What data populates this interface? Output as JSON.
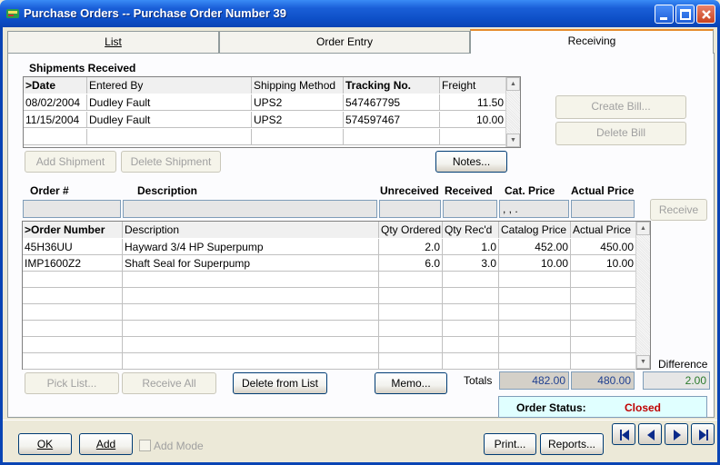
{
  "window": {
    "title": "Purchase Orders -- Purchase Order Number 39",
    "minimize_icon": "minimize-icon",
    "maximize_icon": "maximize-icon",
    "close_icon": "close-icon"
  },
  "tabs": [
    {
      "label": "List"
    },
    {
      "label": "Order Entry"
    },
    {
      "label": "Receiving",
      "active": true
    }
  ],
  "shipments": {
    "section_label": "Shipments Received",
    "columns": [
      ">Date",
      "Entered By",
      "Shipping Method",
      "Tracking No.",
      "Freight"
    ],
    "rows": [
      [
        "08/02/2004",
        "Dudley Fault",
        "UPS2",
        "547467795",
        "11.50"
      ],
      [
        "11/15/2004",
        "Dudley Fault",
        "UPS2",
        "574597467",
        "10.00"
      ]
    ],
    "buttons": {
      "add": "Add Shipment",
      "delete": "Delete Shipment",
      "notes": "Notes...",
      "create_bill": "Create Bill...",
      "delete_bill": "Delete Bill"
    }
  },
  "entry_headers": {
    "order_no": "Order #",
    "description": "Description",
    "unreceived": "Unreceived",
    "received": "Received",
    "cat_price": "Cat. Price",
    "actual_price": "Actual Price",
    "cat_price_value": ",  ,  .",
    "receive_button": "Receive"
  },
  "items": {
    "columns": [
      ">Order Number",
      "Description",
      "Qty Ordered",
      "Qty Rec'd",
      "Catalog Price",
      "Actual Price"
    ],
    "rows": [
      [
        "45H36UU",
        "Hayward 3/4 HP Superpump",
        "2.0",
        "1.0",
        "452.00",
        "450.00"
      ],
      [
        "IMP1600Z2",
        "Shaft Seal for Superpump",
        "6.0",
        "3.0",
        "10.00",
        "10.00"
      ]
    ]
  },
  "actions": {
    "pick_list": "Pick List...",
    "receive_all": "Receive All",
    "delete_from_list": "Delete from List",
    "memo": "Memo..."
  },
  "totals": {
    "label": "Totals",
    "catalog": "482.00",
    "actual": "480.00",
    "difference_label": "Difference",
    "difference": "2.00"
  },
  "status": {
    "label": "Order Status:",
    "value": "Closed",
    "value_color": "#c00000"
  },
  "footer": {
    "ok": "OK",
    "add": "Add",
    "add_mode": "Add Mode",
    "print": "Print...",
    "reports": "Reports..."
  }
}
